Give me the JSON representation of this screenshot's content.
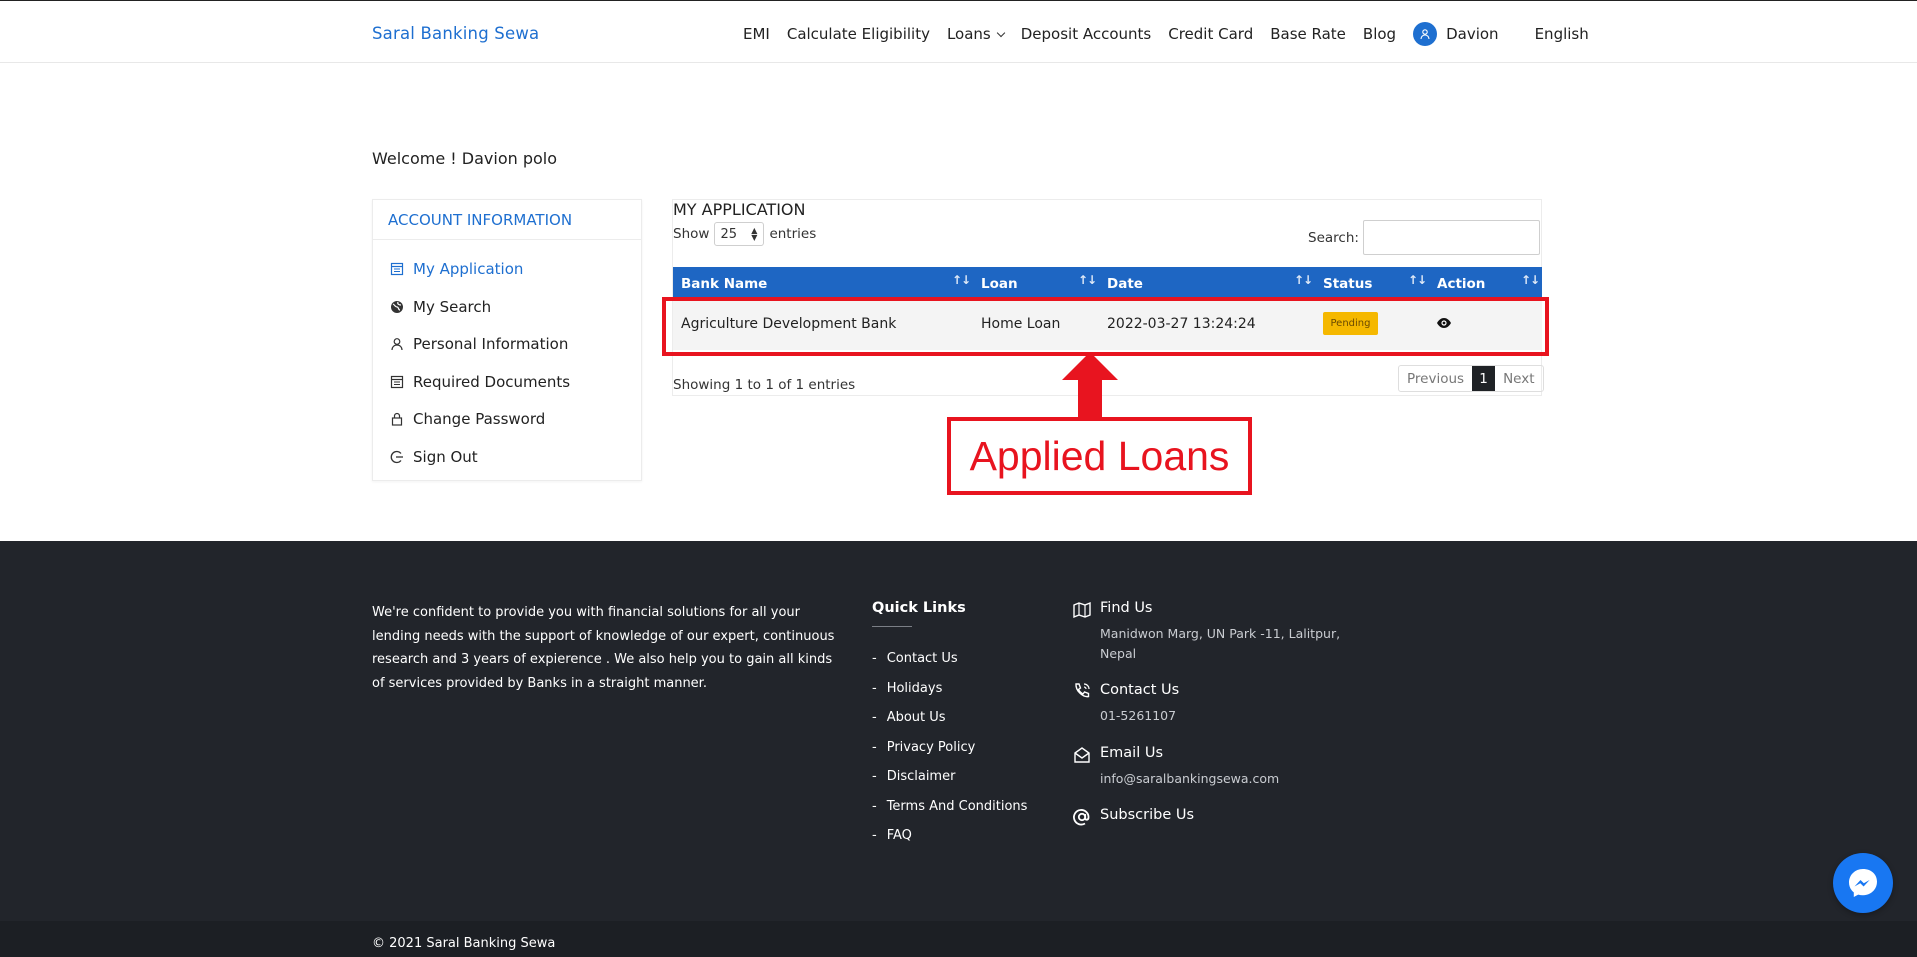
{
  "header": {
    "brand": "Saral Banking Sewa",
    "nav": {
      "emi": "EMI",
      "eligibility": "Calculate Eligibility",
      "loans": "Loans",
      "deposit": "Deposit Accounts",
      "credit": "Credit Card",
      "base_rate": "Base Rate",
      "blog": "Blog"
    },
    "user": "Davion",
    "language": "English"
  },
  "welcome": "Welcome ! Davion polo",
  "sidebar": {
    "title": "ACCOUNT INFORMATION",
    "items": [
      {
        "label": "My Application"
      },
      {
        "label": "My Search"
      },
      {
        "label": "Personal Information"
      },
      {
        "label": "Required Documents"
      },
      {
        "label": "Change Password"
      },
      {
        "label": "Sign Out"
      }
    ]
  },
  "application": {
    "title": "MY APPLICATION",
    "show_label": "Show",
    "entries_count": "25",
    "entries_label": "entries",
    "search_label": "Search:",
    "search_value": "",
    "columns": [
      "Bank Name",
      "Loan",
      "Date",
      "Status",
      "Action"
    ],
    "sort_glyph": "↑↓",
    "rows": [
      {
        "bank": "Agriculture Development Bank",
        "loan": "Home Loan",
        "date": "2022-03-27 13:24:24",
        "status": "Pending"
      }
    ],
    "showing": "Showing 1 to 1 of 1 entries",
    "pagination": {
      "previous": "Previous",
      "current": "1",
      "next": "Next"
    }
  },
  "annotation": {
    "label": "Applied Loans",
    "color": "#e8141f"
  },
  "footer": {
    "about": "We're confident to provide you with financial solutions for all your lending needs with the support of knowledge of our expert, continuous research and 3 years of expierence . We also help you to gain all kinds of services provided by Banks in a straight manner.",
    "quick_links_title": "Quick Links",
    "quick_links": [
      {
        "label": "Contact Us"
      },
      {
        "label": "Holidays"
      },
      {
        "label": "About Us"
      },
      {
        "label": "Privacy Policy"
      },
      {
        "label": "Disclaimer"
      },
      {
        "label": "Terms And Conditions"
      },
      {
        "label": "FAQ"
      }
    ],
    "find_us_title": "Find Us",
    "find_us_text": "Manidwon Marg, UN Park -11, Lalitpur, Nepal",
    "contact_title": "Contact Us",
    "contact_text": "01-5261107",
    "email_title": "Email Us",
    "email_text": "info@saralbankingsewa.com",
    "subscribe_title": "Subscribe Us",
    "copyright": "© 2021 Saral Banking Sewa"
  },
  "colors": {
    "brand_blue": "#1e6fd0",
    "table_header": "#1e66c3",
    "pending": "#f5b800",
    "footer_bg": "#22252b",
    "messenger": "#1877f2"
  }
}
